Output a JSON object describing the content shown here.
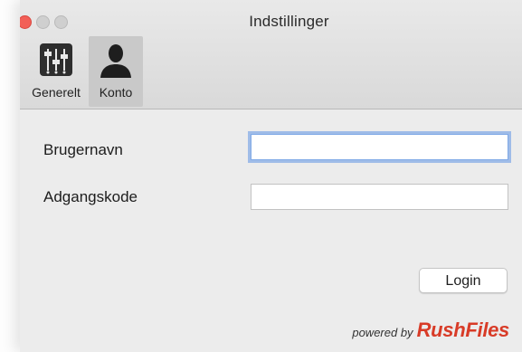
{
  "window": {
    "title": "Indstillinger"
  },
  "toolbar": {
    "tabs": [
      {
        "label": "Generelt",
        "icon": "sliders-icon"
      },
      {
        "label": "Konto",
        "icon": "user-icon"
      }
    ],
    "selected_tab": "Konto"
  },
  "form": {
    "username_label": "Brugernavn",
    "username_value": "",
    "password_label": "Adgangskode",
    "password_value": ""
  },
  "actions": {
    "login_label": "Login"
  },
  "footer": {
    "powered_by": "powered by",
    "brand": "RushFiles"
  },
  "colors": {
    "brand": "#d83b27",
    "focus_ring": "#6196e6",
    "close_button": "#f25f57"
  }
}
